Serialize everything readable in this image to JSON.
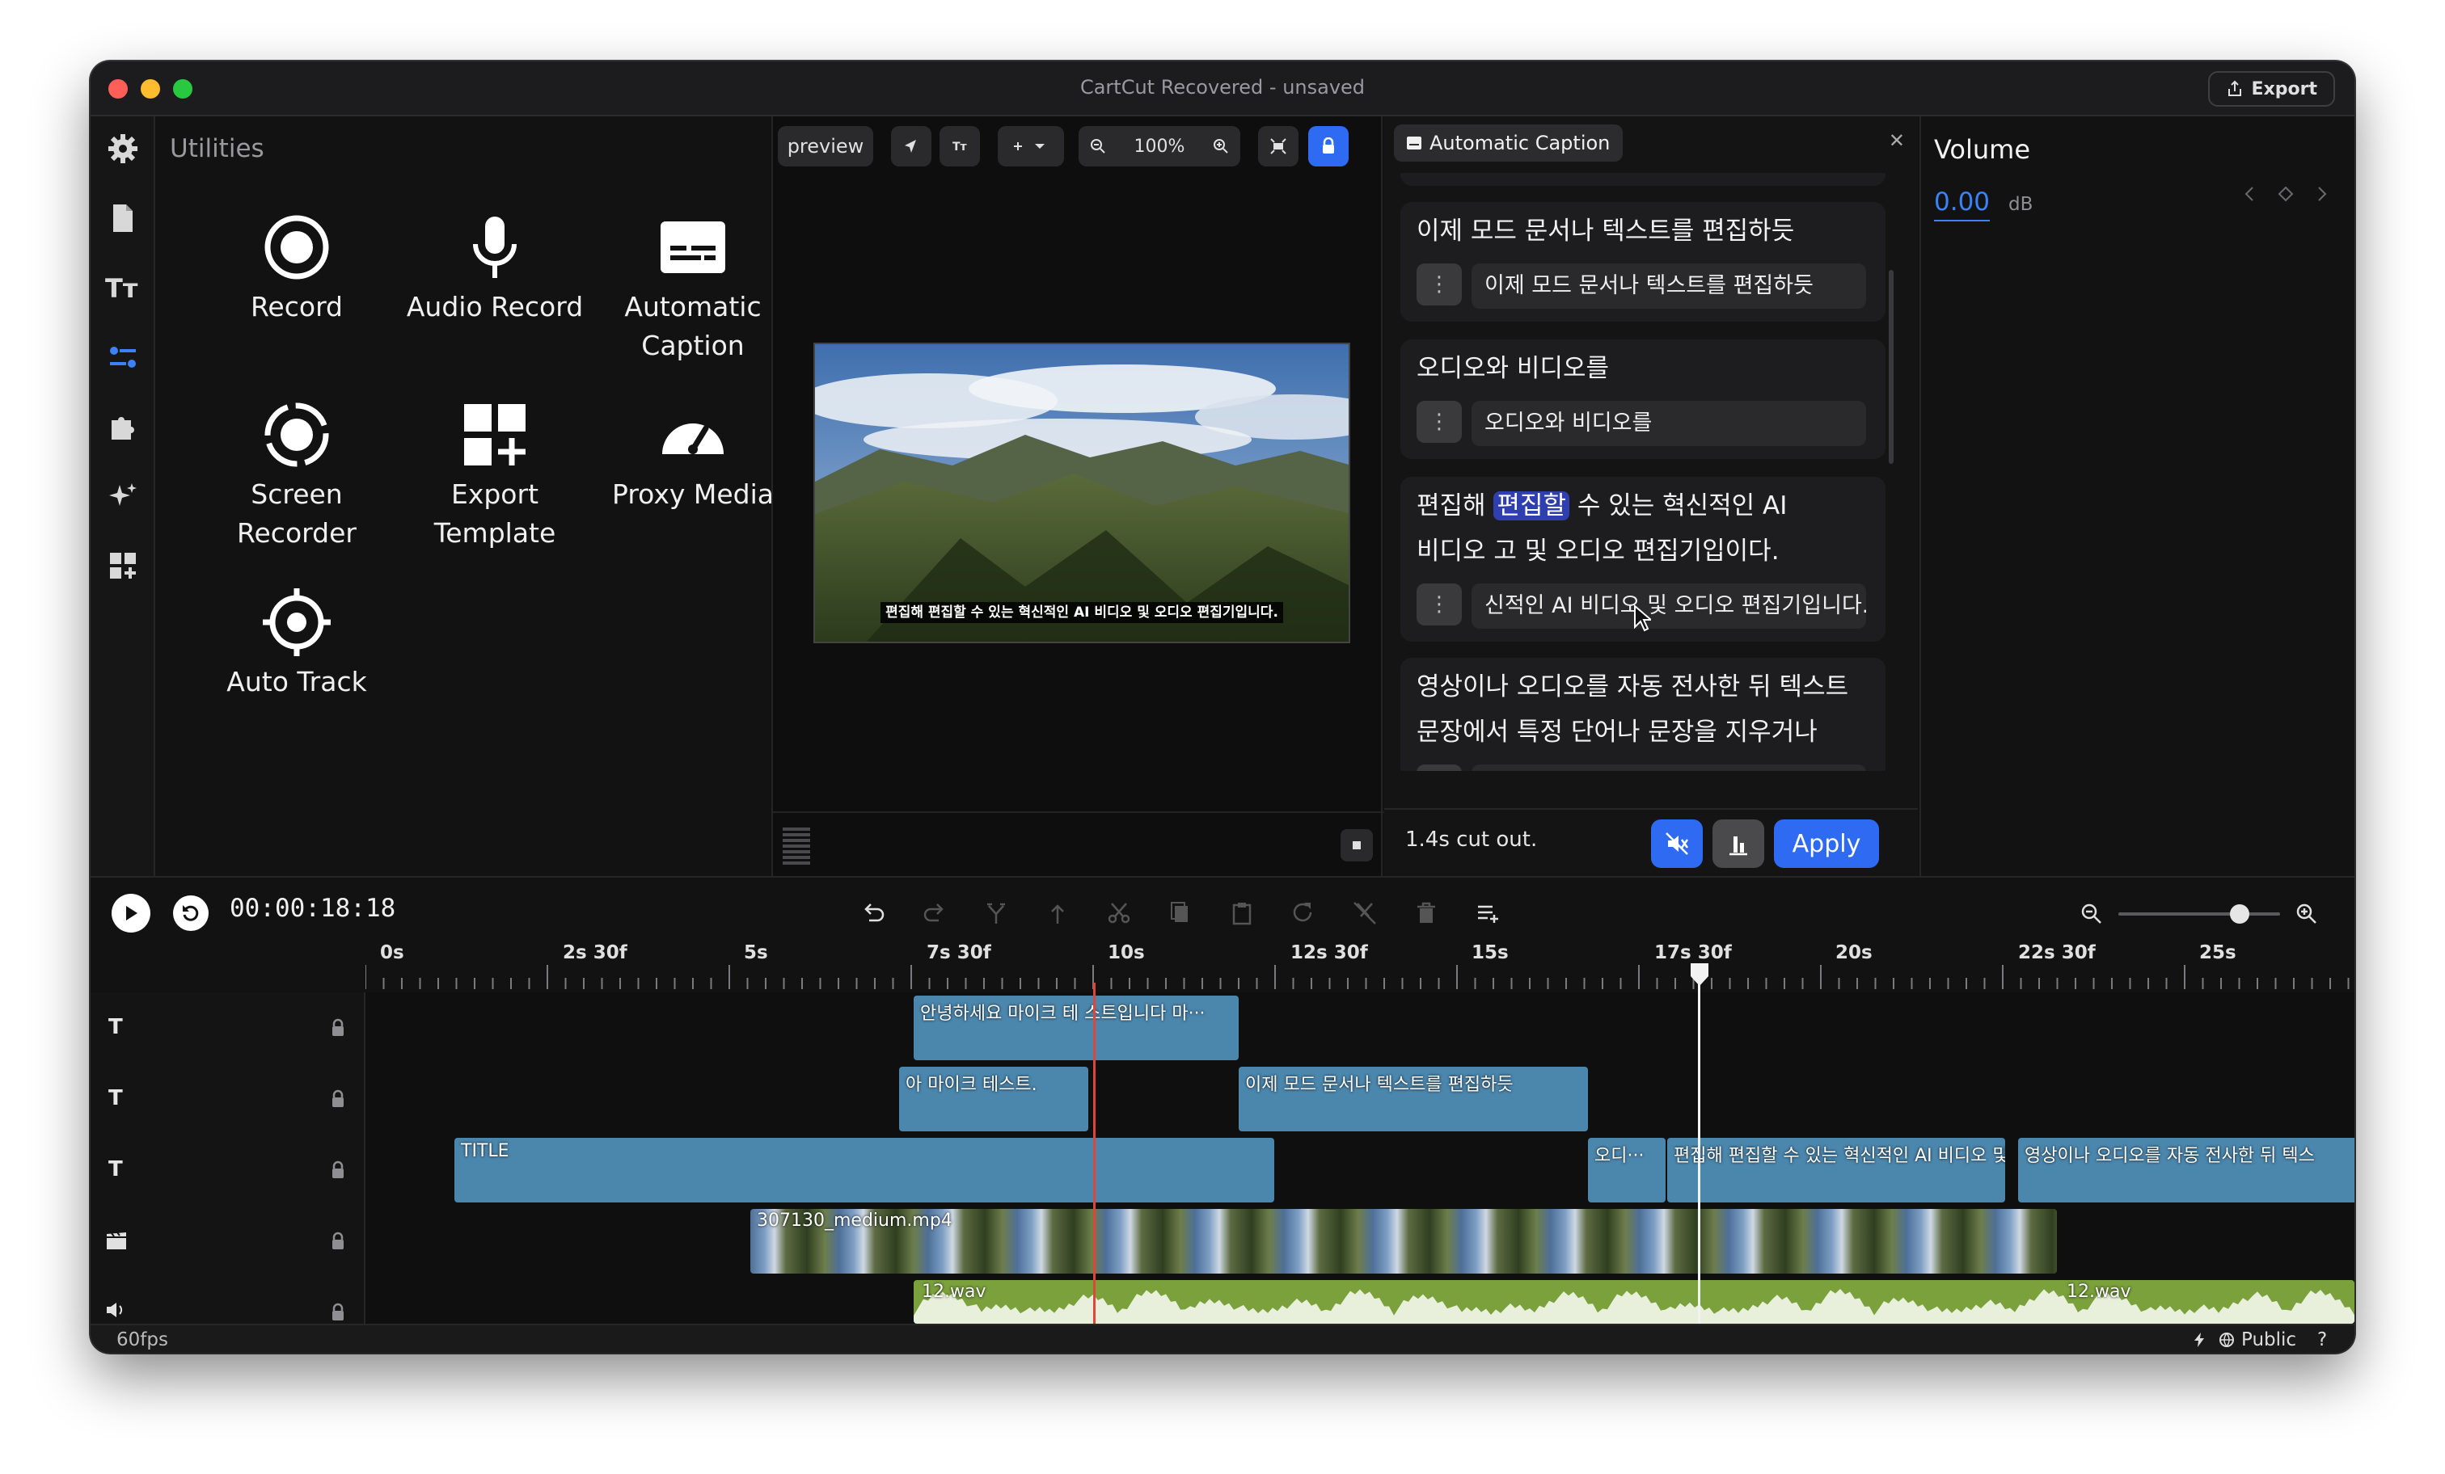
{
  "window": {
    "title": "CartCut Recovered - unsaved",
    "export_label": "Export"
  },
  "nav": {
    "icons": [
      "gear-icon",
      "file-icon",
      "text-icon",
      "sliders-icon",
      "puzzle-icon",
      "sparkles-icon",
      "widgets-icon"
    ],
    "active": "sliders-icon"
  },
  "utilities": {
    "title": "Utilities",
    "items": [
      {
        "label": "Record",
        "icon": "record-icon"
      },
      {
        "label": "Audio Record",
        "icon": "microphone-icon"
      },
      {
        "label": "Automatic Caption",
        "icon": "caption-icon"
      },
      {
        "label": "Screen Recorder",
        "icon": "screen-record-icon"
      },
      {
        "label": "Export Template",
        "icon": "template-icon"
      },
      {
        "label": "Proxy Media",
        "icon": "gauge-icon"
      },
      {
        "label": "Auto Track",
        "icon": "crosshair-icon"
      }
    ]
  },
  "preview": {
    "mode_label": "preview",
    "zoom_label": "100%",
    "caption_text": "편집해 편집할 수 있는 혁신적인 AI 비디오 및 오디오 편집기입니다."
  },
  "caption_panel": {
    "tab_label": "Automatic Caption",
    "cards": [
      {
        "text_lines": [
          "이제 모드 문서나 텍스트를 편집하듯"
        ],
        "field": "이제 모드 문서나 텍스트를 편집하듯"
      },
      {
        "text_lines": [
          "오디오와 비디오를"
        ],
        "field": "오디오와 비디오를"
      },
      {
        "text_lines": [
          "편집해 편집할 수 있는 혁신적인 AI",
          "비디오 고 및 오디오 편집기입이다."
        ],
        "highlight": "편집할",
        "field": "신적인 AI 비디오 및 오디오 편집기입니다."
      },
      {
        "text_lines": [
          "영상이나 오디오를 자동 전사한 뒤 텍스트",
          "문장에서 특정 단어나 문장을 지우거나"
        ],
        "field": ""
      }
    ],
    "cut_status": "1.4s cut out.",
    "apply_label": "Apply",
    "colors": {
      "accent": "#2f6bf2"
    }
  },
  "volume": {
    "title": "Volume",
    "value": "0.00",
    "unit": "dB"
  },
  "timeline": {
    "timecode": "00:00:18:18",
    "ruler_labels": [
      "0s",
      "2s 30f",
      "5s",
      "7s 30f",
      "10s",
      "12s 30f",
      "15s",
      "17s 30f",
      "20s",
      "22s 30f",
      "25s"
    ],
    "zoom_level": 0.75,
    "tracks": [
      {
        "type": "text",
        "icon_label": "T",
        "clips": [
          {
            "label": "안녕하세요 마이크  테 스트입니다 마···"
          }
        ]
      },
      {
        "type": "text",
        "icon_label": "T",
        "clips": [
          {
            "label": "아 마이크 테스트."
          },
          {
            "label": "이제 모드 문서나 텍스트를 편집하듯"
          }
        ]
      },
      {
        "type": "text",
        "icon_label": "T",
        "clips": [
          {
            "label": "TITLE"
          },
          {
            "label": "오디···"
          },
          {
            "label": "편집해 편집할 수 있는 혁신적인 AI 비디오 및 ···"
          },
          {
            "label": "영상이나 오디오를 자동 전사한 뒤 텍스"
          }
        ]
      },
      {
        "type": "video",
        "clips": [
          {
            "label": "307130_medium.mp4"
          }
        ]
      },
      {
        "type": "audio",
        "clips": [
          {
            "label": "12.wav"
          },
          {
            "label": "12.wav"
          }
        ]
      }
    ]
  },
  "status": {
    "fps": "60fps",
    "visibility": "Public",
    "help": "?"
  }
}
